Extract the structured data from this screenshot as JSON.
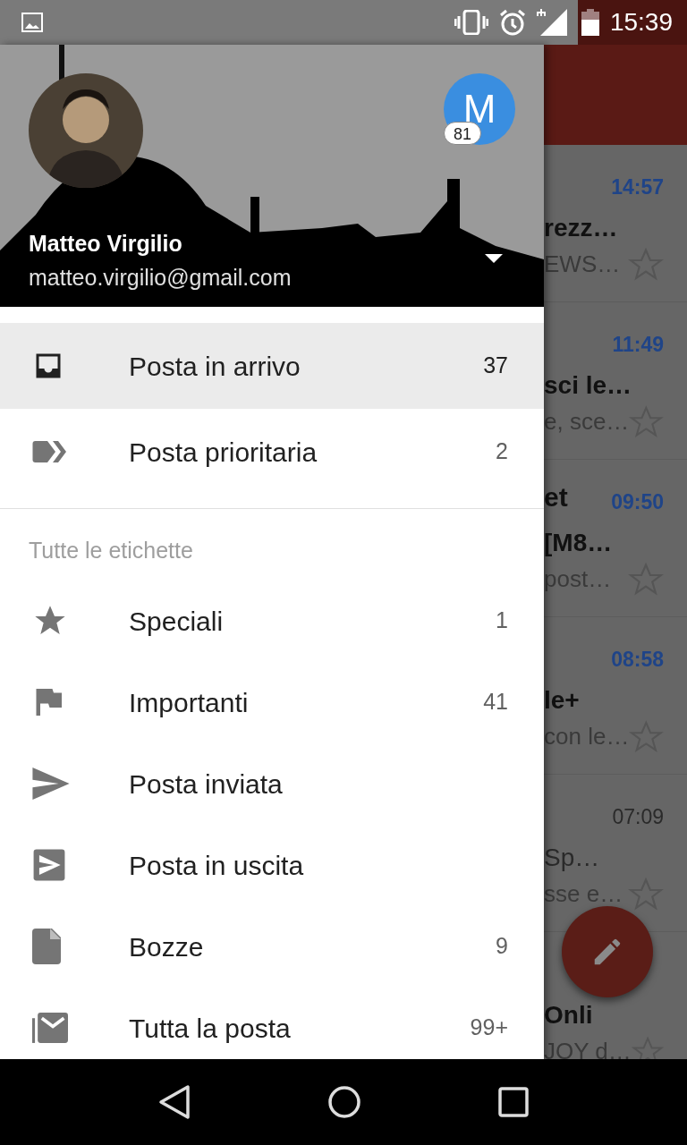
{
  "status_bar": {
    "time": "15:39"
  },
  "drawer": {
    "account": {
      "name": "Matteo Virgilio",
      "email": "matteo.virgilio@gmail.com"
    },
    "other_account": {
      "initial": "M",
      "badge": "81"
    },
    "items": [
      {
        "label": "Posta in arrivo",
        "count": "37",
        "selected": true
      },
      {
        "label": "Posta prioritaria",
        "count": "2",
        "selected": false
      }
    ],
    "section_label": "Tutte le etichette",
    "labels": [
      {
        "label": "Speciali",
        "count": "1"
      },
      {
        "label": "Importanti",
        "count": "41"
      },
      {
        "label": "Posta inviata"
      },
      {
        "label": "Posta in uscita"
      },
      {
        "label": "Bozze",
        "count": "9"
      },
      {
        "label": "Tutta la posta",
        "count": "99+"
      }
    ]
  },
  "messages": [
    {
      "time": "14:57",
      "unread": true,
      "subject": "rezz…",
      "snippet": "EWS…"
    },
    {
      "time": "11:49",
      "unread": true,
      "subject": "sci le…",
      "snippet": "e, sce…"
    },
    {
      "time": "09:50",
      "unread": true,
      "sender": "et",
      "subject": "[M8…",
      "snippet": "post…"
    },
    {
      "time": "08:58",
      "unread": true,
      "subject": "le+",
      "snippet": "con le…"
    },
    {
      "time": "07:09",
      "unread": false,
      "subject": "Sp…",
      "snippet": "sse e…"
    },
    {
      "unread": true,
      "subject": "Onli",
      "snippet": "JOY d…"
    }
  ]
}
